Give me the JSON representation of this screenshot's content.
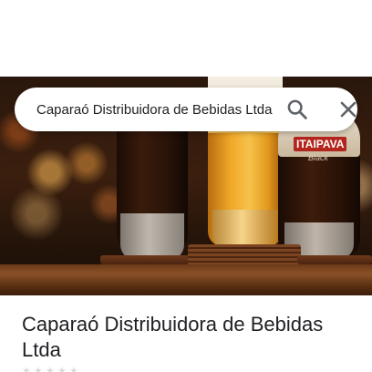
{
  "search": {
    "value": "Caparaó Distribuidora de Bebidas Ltda"
  },
  "hero": {
    "brand_text_1": "ITAIPAVA",
    "brand_text_2": "Black"
  },
  "place": {
    "title": "Caparaó Distribuidora de Bebidas Ltda"
  },
  "icons": {
    "search": "search-icon",
    "close": "close-icon",
    "star": "star-icon"
  },
  "colors": {
    "text_primary": "#202124",
    "icon_gray": "#5f6368"
  }
}
